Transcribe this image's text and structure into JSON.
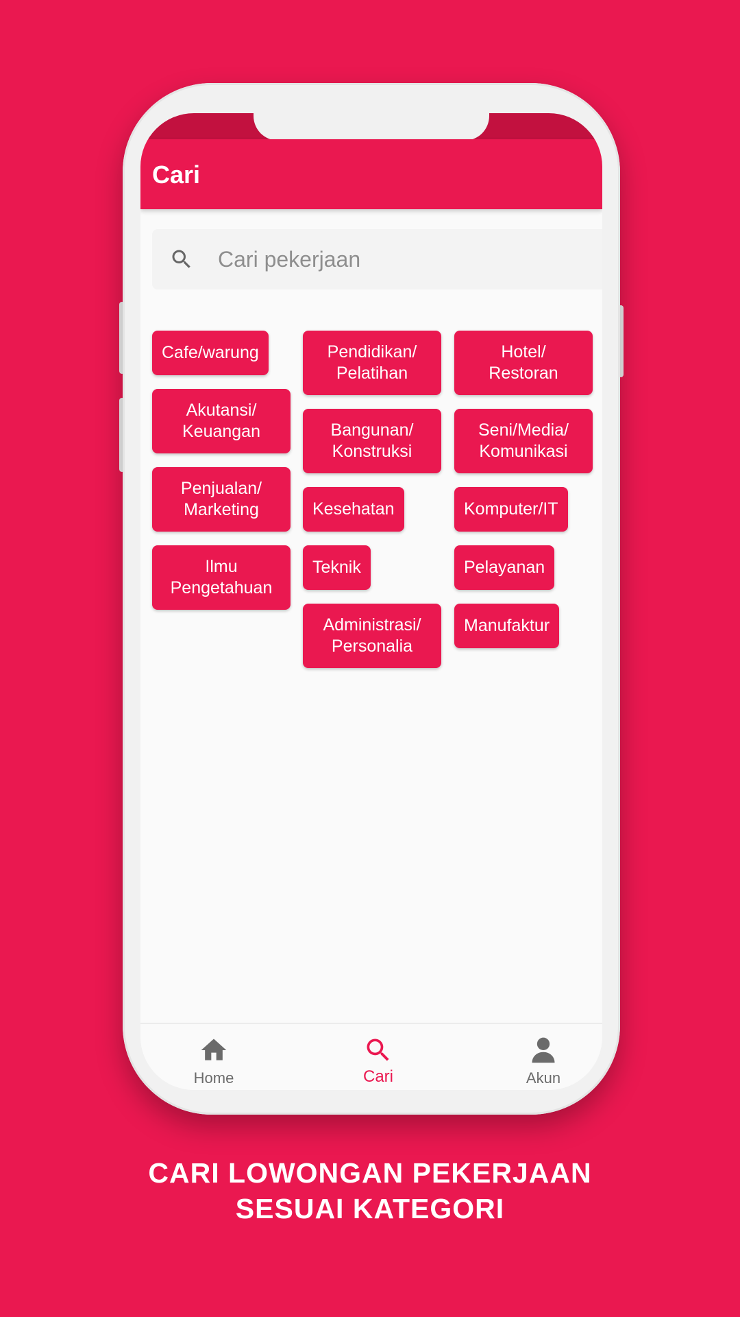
{
  "colors": {
    "brand": "#EA1850",
    "brand_dark": "#C2113F",
    "nav_inactive": "#6B6B6B",
    "placeholder": "#8E8E8E"
  },
  "app_bar": {
    "title": "Cari"
  },
  "search": {
    "icon": "search-icon",
    "placeholder": "Cari pekerjaan"
  },
  "categories": {
    "column_1": [
      {
        "label": "Cafe/warung"
      },
      {
        "label": "Akutansi/\nKeuangan"
      },
      {
        "label": "Penjualan/\nMarketing"
      },
      {
        "label": "Ilmu\nPengetahuan"
      }
    ],
    "column_2": [
      {
        "label": "Pendidikan/\nPelatihan"
      },
      {
        "label": "Bangunan/\nKonstruksi"
      },
      {
        "label": "Kesehatan"
      },
      {
        "label": "Teknik"
      },
      {
        "label": "Administrasi/\nPersonalia"
      }
    ],
    "column_3": [
      {
        "label": "Hotel/\nRestoran"
      },
      {
        "label": "Seni/Media/\nKomunikasi"
      },
      {
        "label": "Komputer/IT"
      },
      {
        "label": "Pelayanan"
      },
      {
        "label": "Manufaktur"
      }
    ]
  },
  "bottom_nav": {
    "items": [
      {
        "label": "Home",
        "icon": "home-icon",
        "active": false
      },
      {
        "label": "Cari",
        "icon": "search-icon",
        "active": true
      },
      {
        "label": "Akun",
        "icon": "account-icon",
        "active": false
      }
    ]
  },
  "caption": {
    "line1": "CARI LOWONGAN PEKERJAAN",
    "line2": "SESUAI KATEGORI"
  }
}
